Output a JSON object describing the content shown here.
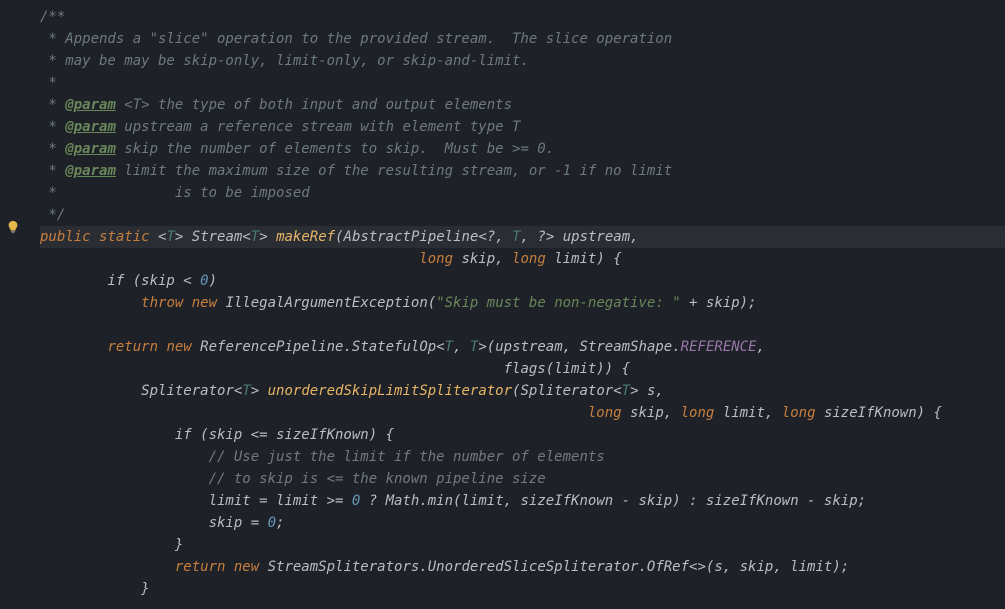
{
  "colors": {
    "background": "#1e2127",
    "comment": "#6c7a80",
    "keyword": "#c77f3d",
    "method": "#e6b566",
    "string": "#69875a",
    "number": "#6897bb",
    "field": "#9876aa"
  },
  "doc": {
    "l1": "/**",
    "l2": " * Appends a \"slice\" operation to the provided stream.  The slice operation",
    "l3": " * may be may be skip-only, limit-only, or skip-and-limit.",
    "l4": " *",
    "l5a": " * ",
    "l5tag": "@param",
    "l5b": " <T> the type of both input and output elements",
    "l6a": " * ",
    "l6tag": "@param",
    "l6b": " upstream a reference stream with element type T",
    "l7a": " * ",
    "l7tag": "@param",
    "l7b": " skip the number of elements to skip.  Must be >= 0.",
    "l8a": " * ",
    "l8tag": "@param",
    "l8b": " limit the maximum size of the resulting stream, or -1 if no limit",
    "l9": " *              is to be imposed",
    "l10": " */"
  },
  "sig": {
    "kw_public": "public ",
    "kw_static": "static ",
    "lt1": "<",
    "T": "T",
    "gt1": "> ",
    "stream": "Stream",
    "lt2": "<",
    "gt2": "> ",
    "name": "makeRef",
    "open": "(",
    "ap": "AbstractPipeline",
    "apg": "<?, ",
    "apg2": ", ?> ",
    "p1": "upstream,",
    "indent2": "                                             ",
    "long1": "long ",
    "p2": "skip, ",
    "long2": "long ",
    "p3": "limit) {"
  },
  "body": {
    "if_l": "        if (skip < ",
    "zero": "0",
    "if_r": ")",
    "throw_pre": "            ",
    "kw_throw": "throw ",
    "kw_new": "new ",
    "exc": "IllegalArgumentException",
    "open": "(",
    "str": "\"Skip must be non-negative: \"",
    "plus": " + skip);",
    "ret_pre": "        ",
    "kw_return": "return ",
    "kw_new2": "new ",
    "refpipe": "ReferencePipeline.StatefulOp",
    "g_open": "<",
    "g_mid": ", ",
    "g_close": ">",
    "args1": "(upstream, StreamShape.",
    "ref_const": "REFERENCE",
    "args1b": ",",
    "args2_pre": "                                                       ",
    "args2": "flags(limit)) {",
    "m2_pre": "            ",
    "m2_type": "Spliterator",
    "m2_g": "<",
    "m2_g2": "> ",
    "m2_name": "unorderedSkipLimitSpliterator",
    "m2_open": "(Spliterator",
    "m2_g3": "<",
    "m2_g4": "> ",
    "m2_p1": "s,",
    "m2_l2_pre": "                                                                 ",
    "m2_long1": "long ",
    "m2_p2": "skip, ",
    "m2_long2": "long ",
    "m2_p3": "limit, ",
    "m2_long3": "long ",
    "m2_p4": "sizeIfKnown) {",
    "if2_pre": "                if (skip <= sizeIfKnown) {",
    "cm1": "                    // Use just the limit if the number of elements",
    "cm2": "                    // to skip is <= the known pipeline size",
    "asgn1_pre": "                    limit = limit >= ",
    "asgn1_mid": " ? Math.",
    "min": "min",
    "asgn1_rest": "(limit, sizeIfKnown - skip) : sizeIfKnown - skip;",
    "asgn2_pre": "                    skip = ",
    "asgn2_end": ";",
    "close1": "                }",
    "ret2_pre": "                ",
    "kw_return2": "return ",
    "kw_new3": "new ",
    "ss": "StreamSpliterators.UnorderedSliceSpliterator.OfRef<>(s, skip, limit);",
    "close2": "            }"
  },
  "icons": {
    "bulb": "lightbulb-icon"
  }
}
